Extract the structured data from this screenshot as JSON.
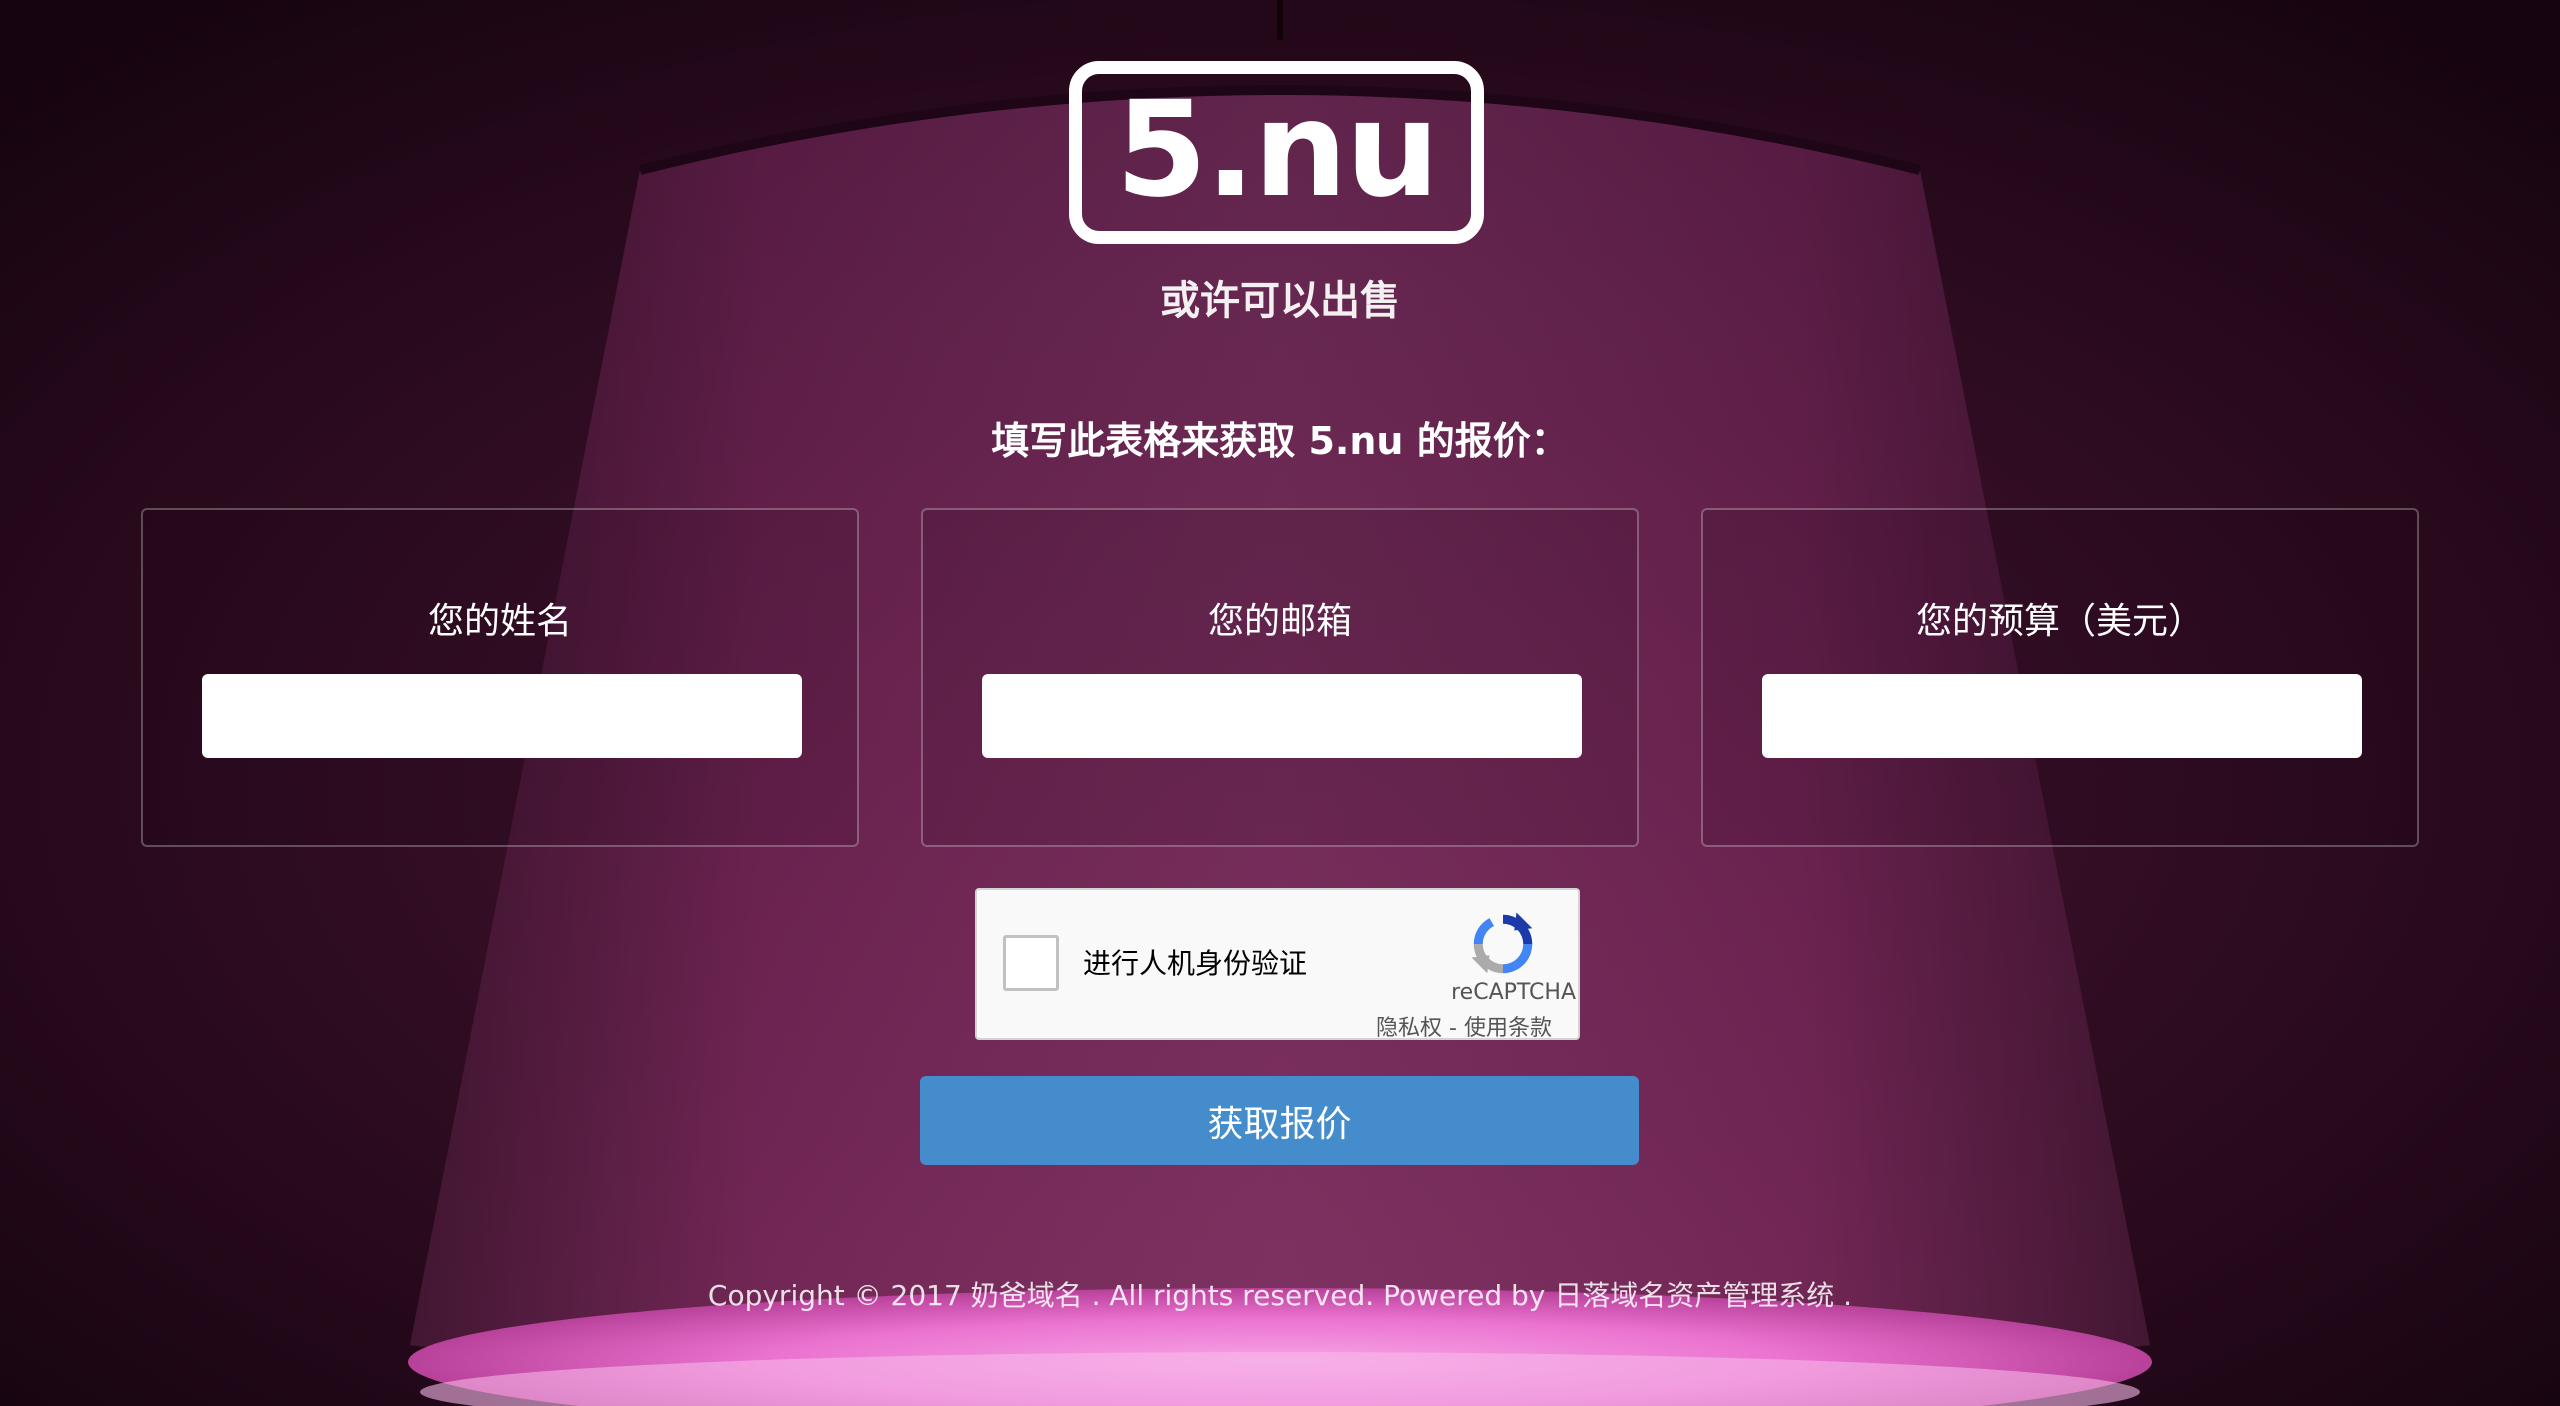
{
  "logo": {
    "text": "5.nu"
  },
  "tagline": "或许可以出售",
  "form": {
    "heading": "填写此表格来获取 5.nu 的报价：",
    "fields": [
      {
        "label": "您的姓名",
        "value": "",
        "placeholder": ""
      },
      {
        "label": "您的邮箱",
        "value": "",
        "placeholder": ""
      },
      {
        "label": "您的预算（美元）",
        "value": "",
        "placeholder": ""
      }
    ],
    "submit_label": "获取报价"
  },
  "captcha": {
    "label": "进行人机身份验证",
    "brand": "reCAPTCHA",
    "privacy": "隐私权",
    "separator": " - ",
    "terms": "使用条款",
    "icon": "recaptcha-icon"
  },
  "footer": {
    "text": "Copyright © 2017 奶爸域名 . All rights reserved. Powered by 日落域名资产管理系统 ."
  },
  "colors": {
    "button": "#448ccb",
    "background": "#2a0a1c",
    "lamp_glow": "#f07ad8"
  }
}
